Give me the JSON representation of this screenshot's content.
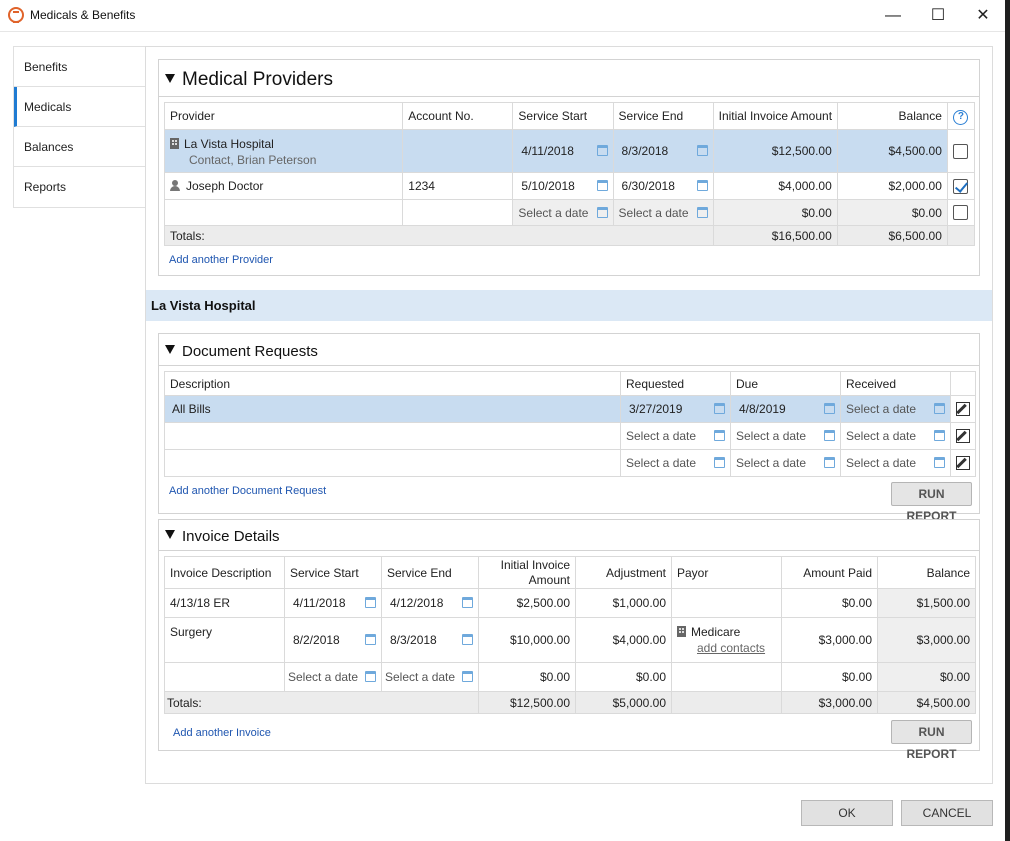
{
  "window": {
    "title": "Medicals & Benefits",
    "minimize": "—",
    "maximize": "☐",
    "close": "✕"
  },
  "sidebar": {
    "items": [
      {
        "label": "Benefits"
      },
      {
        "label": "Medicals"
      },
      {
        "label": "Balances"
      },
      {
        "label": "Reports"
      }
    ]
  },
  "providers": {
    "title": "Medical Providers",
    "headers": {
      "provider": "Provider",
      "account": "Account No.",
      "start": "Service Start",
      "end": "Service End",
      "initial": "Initial Invoice Amount",
      "balance": "Balance",
      "help": "?"
    },
    "rows": [
      {
        "name": "La Vista Hospital",
        "contact": "Contact, Brian Peterson",
        "account": "",
        "start": "4/11/2018",
        "end": "8/3/2018",
        "initial": "$12,500.00",
        "balance": "$4,500.00"
      },
      {
        "name": "Joseph Doctor",
        "account": "1234",
        "start": "5/10/2018",
        "end": "6/30/2018",
        "initial": "$4,000.00",
        "balance": "$2,000.00"
      },
      {
        "start": "Select a date",
        "end": "Select a date",
        "initial": "$0.00",
        "balance": "$0.00"
      }
    ],
    "totals": {
      "label": "Totals:",
      "initial": "$16,500.00",
      "balance": "$6,500.00"
    },
    "add_link": "Add another Provider"
  },
  "selected_provider": "La Vista Hospital",
  "documents": {
    "title": "Document Requests",
    "headers": {
      "description": "Description",
      "requested": "Requested",
      "due": "Due",
      "received": "Received"
    },
    "rows": [
      {
        "description": "All Bills",
        "requested": "3/27/2019",
        "due": "4/8/2019",
        "received": "Select a date"
      },
      {
        "description": "",
        "requested": "Select a date",
        "due": "Select a date",
        "received": "Select a date"
      },
      {
        "description": "",
        "requested": "Select a date",
        "due": "Select a date",
        "received": "Select a date"
      }
    ],
    "add_link": "Add another Document Request",
    "run_report": "RUN REPORT"
  },
  "invoices": {
    "title": "Invoice Details",
    "headers": {
      "description": "Invoice Description",
      "start": "Service Start",
      "end": "Service End",
      "initial1": "Initial Invoice",
      "initial2": "Amount",
      "adjustment": "Adjustment",
      "payor": "Payor",
      "paid": "Amount Paid",
      "balance": "Balance"
    },
    "rows": [
      {
        "description": "4/13/18 ER",
        "start": "4/11/2018",
        "end": "4/12/2018",
        "initial": "$2,500.00",
        "adjustment": "$1,000.00",
        "payor": "",
        "paid": "$0.00",
        "balance": "$1,500.00"
      },
      {
        "description": "Surgery",
        "start": "8/2/2018",
        "end": "8/3/2018",
        "initial": "$10,000.00",
        "adjustment": "$4,000.00",
        "payor": "Medicare",
        "payor_link": "add contacts",
        "paid": "$3,000.00",
        "balance": "$3,000.00"
      },
      {
        "description": "",
        "start": "Select a date",
        "end": "Select a date",
        "initial": "$0.00",
        "adjustment": "$0.00",
        "payor": "",
        "paid": "$0.00",
        "balance": "$0.00"
      }
    ],
    "totals": {
      "label": "Totals:",
      "initial": "$12,500.00",
      "adjustment": "$5,000.00",
      "paid": "$3,000.00",
      "balance": "$4,500.00"
    },
    "add_link": "Add another Invoice",
    "run_report": "RUN REPORT"
  },
  "footer": {
    "ok": "OK",
    "cancel": "CANCEL"
  },
  "colors": {
    "accent": "#1f7bd2",
    "selected_row": "#c8dcf0",
    "section_band": "#dbe8f5"
  }
}
